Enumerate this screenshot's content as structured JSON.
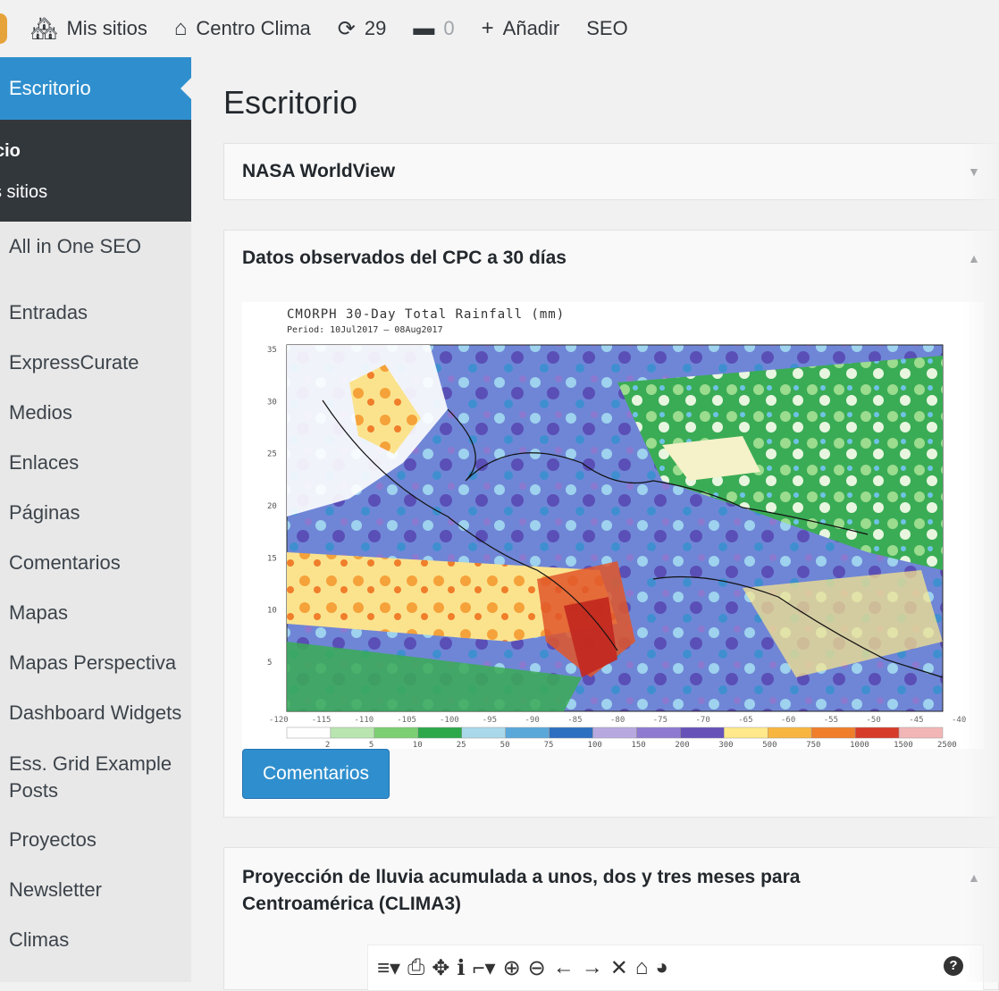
{
  "adminbar": {
    "my_sites_label": "Mis sitios",
    "site_name": "Centro Clima",
    "updates_count": "29",
    "comments_count": "0",
    "add_label": "Añadir",
    "seo_label": "SEO"
  },
  "sidebar": {
    "active_label": "Escritorio",
    "submenu": [
      "cio",
      "s sitios"
    ],
    "items": [
      "All in One SEO",
      "Entradas",
      "ExpressCurate",
      "Medios",
      "Enlaces",
      "Páginas",
      "Comentarios",
      "Mapas",
      "Mapas Perspectiva",
      "Dashboard Widgets",
      "Ess. Grid Example Posts",
      "Proyectos",
      "Newsletter",
      "Climas"
    ]
  },
  "main": {
    "title": "Escritorio",
    "panels": [
      {
        "title": "NASA WorldView",
        "toggle": "▼"
      },
      {
        "title": "Datos observados del CPC a 30 días",
        "toggle": "▲",
        "button": "Comentarios"
      },
      {
        "title": "Proyección de lluvia acumulada a unos, dos y tres meses para Centroamérica (CLIMA3)",
        "toggle": "▲"
      }
    ]
  },
  "chart": {
    "title": "CMORPH 30-Day Total Rainfall (mm)",
    "period": "Period: 10Jul2017 – 08Aug2017",
    "y_ticks": [
      "35",
      "30",
      "25",
      "20",
      "15",
      "10",
      "5"
    ],
    "x_ticks": [
      "-120",
      "-115",
      "-110",
      "-105",
      "-100",
      "-95",
      "-90",
      "-85",
      "-80",
      "-75",
      "-70",
      "-65",
      "-60",
      "-55",
      "-50",
      "-45",
      "-40"
    ],
    "legend_labels": [
      "2",
      "5",
      "10",
      "25",
      "50",
      "75",
      "100",
      "150",
      "200",
      "300",
      "500",
      "750",
      "1000",
      "1500",
      "2500"
    ],
    "legend_colors": [
      "#ffffff",
      "#b9e6b0",
      "#7ccf72",
      "#2ca84a",
      "#a9d8ea",
      "#5aa7da",
      "#2d6fc0",
      "#b7a9e0",
      "#8e7ad0",
      "#6652b8",
      "#ffe98a",
      "#f8b640",
      "#f07e2a",
      "#d63b2a",
      "#f2b6b6"
    ]
  },
  "toolbar": {
    "icons": [
      "≡▾",
      "⎙",
      "✥",
      "ℹ",
      "⌐▾",
      "⊕",
      "⊖",
      "←",
      "→",
      "✕",
      "⌂",
      "◕"
    ],
    "help": "?"
  }
}
